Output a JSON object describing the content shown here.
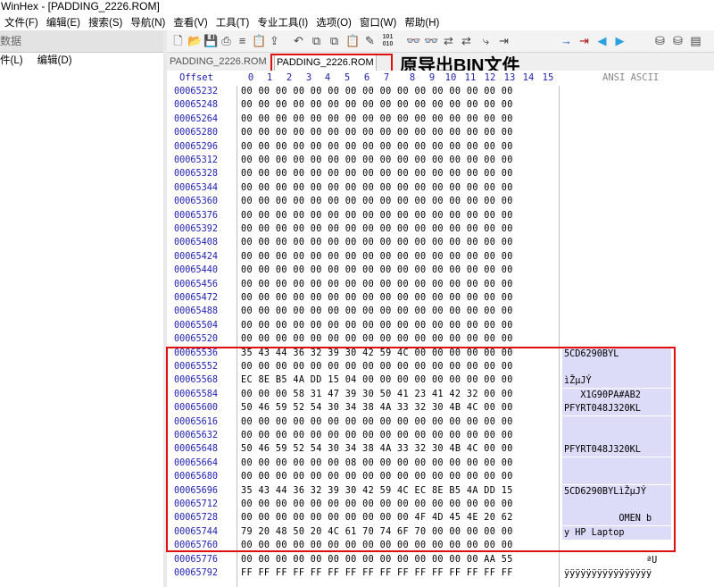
{
  "window": {
    "title": "WinHex - [PADDING_2226.ROM]"
  },
  "menu": [
    "文件(F)",
    "编辑(E)",
    "搜索(S)",
    "导航(N)",
    "查看(V)",
    "工具(T)",
    "专业工具(I)",
    "选项(O)",
    "窗口(W)",
    "帮助(H)"
  ],
  "left_pane": {
    "header": "数据",
    "menu": [
      "件(L)",
      "编辑(D)"
    ]
  },
  "toolbar_icons": [
    "new-file-icon",
    "open-folder-icon",
    "save-icon",
    "print-icon",
    "properties-icon",
    "clipboard-icon",
    "export-icon",
    "undo-icon",
    "copy-icon",
    "copy-block-icon",
    "paste-icon",
    "write-icon",
    "hex-101-icon",
    "find-text-icon",
    "find-hex-icon",
    "replace-icon",
    "replace-hex-icon",
    "goto-icon",
    "goto-offset-icon",
    "back-icon",
    "forward-icon",
    "disk-icon",
    "disk-edit-icon",
    "ram-icon"
  ],
  "tabs": [
    {
      "label": "PADDING_2226.ROM",
      "active": false
    },
    {
      "label": "PADDING_2226.ROM",
      "active": true
    }
  ],
  "annotation": {
    "text": "原导出BIN文件",
    "color": "#e01010"
  },
  "hex": {
    "offset_header": "Offset",
    "columns": [
      "0",
      "1",
      "2",
      "3",
      "4",
      "5",
      "6",
      "7",
      "8",
      "9",
      "10",
      "11",
      "12",
      "13",
      "14",
      "15"
    ],
    "ascii_header": "ANSI ASCII",
    "rows": [
      {
        "offset": "00065232",
        "bytes": "00 00 00 00 00 00 00 00 00 00 00 00 00 00 00 00",
        "ascii": "",
        "hl": false
      },
      {
        "offset": "00065248",
        "bytes": "00 00 00 00 00 00 00 00 00 00 00 00 00 00 00 00",
        "ascii": "",
        "hl": false
      },
      {
        "offset": "00065264",
        "bytes": "00 00 00 00 00 00 00 00 00 00 00 00 00 00 00 00",
        "ascii": "",
        "hl": false
      },
      {
        "offset": "00065280",
        "bytes": "00 00 00 00 00 00 00 00 00 00 00 00 00 00 00 00",
        "ascii": "",
        "hl": false
      },
      {
        "offset": "00065296",
        "bytes": "00 00 00 00 00 00 00 00 00 00 00 00 00 00 00 00",
        "ascii": "",
        "hl": false
      },
      {
        "offset": "00065312",
        "bytes": "00 00 00 00 00 00 00 00 00 00 00 00 00 00 00 00",
        "ascii": "",
        "hl": false
      },
      {
        "offset": "00065328",
        "bytes": "00 00 00 00 00 00 00 00 00 00 00 00 00 00 00 00",
        "ascii": "",
        "hl": false
      },
      {
        "offset": "00065344",
        "bytes": "00 00 00 00 00 00 00 00 00 00 00 00 00 00 00 00",
        "ascii": "",
        "hl": false
      },
      {
        "offset": "00065360",
        "bytes": "00 00 00 00 00 00 00 00 00 00 00 00 00 00 00 00",
        "ascii": "",
        "hl": false
      },
      {
        "offset": "00065376",
        "bytes": "00 00 00 00 00 00 00 00 00 00 00 00 00 00 00 00",
        "ascii": "",
        "hl": false
      },
      {
        "offset": "00065392",
        "bytes": "00 00 00 00 00 00 00 00 00 00 00 00 00 00 00 00",
        "ascii": "",
        "hl": false
      },
      {
        "offset": "00065408",
        "bytes": "00 00 00 00 00 00 00 00 00 00 00 00 00 00 00 00",
        "ascii": "",
        "hl": false
      },
      {
        "offset": "00065424",
        "bytes": "00 00 00 00 00 00 00 00 00 00 00 00 00 00 00 00",
        "ascii": "",
        "hl": false
      },
      {
        "offset": "00065440",
        "bytes": "00 00 00 00 00 00 00 00 00 00 00 00 00 00 00 00",
        "ascii": "",
        "hl": false
      },
      {
        "offset": "00065456",
        "bytes": "00 00 00 00 00 00 00 00 00 00 00 00 00 00 00 00",
        "ascii": "",
        "hl": false
      },
      {
        "offset": "00065472",
        "bytes": "00 00 00 00 00 00 00 00 00 00 00 00 00 00 00 00",
        "ascii": "",
        "hl": false
      },
      {
        "offset": "00065488",
        "bytes": "00 00 00 00 00 00 00 00 00 00 00 00 00 00 00 00",
        "ascii": "",
        "hl": false
      },
      {
        "offset": "00065504",
        "bytes": "00 00 00 00 00 00 00 00 00 00 00 00 00 00 00 00",
        "ascii": "",
        "hl": false
      },
      {
        "offset": "00065520",
        "bytes": "00 00 00 00 00 00 00 00 00 00 00 00 00 00 00 00",
        "ascii": "",
        "hl": false
      },
      {
        "offset": "00065536",
        "bytes": "35 43 44 36 32 39 30 42 59 4C 00 00 00 00 00 00",
        "ascii": "5CD6290BYL",
        "hl": true
      },
      {
        "offset": "00065552",
        "bytes": "00 00 00 00 00 00 00 00 00 00 00 00 00 00 00 00",
        "ascii": "",
        "hl": true
      },
      {
        "offset": "00065568",
        "bytes": "EC 8E B5 4A DD 15 04 00 00 00 00 00 00 00 00 00",
        "ascii": "ìŽµJÝ",
        "hl": true
      },
      {
        "offset": "00065584",
        "bytes": "00 00 00 58 31 47 39 30 50 41 23 41 42 32 00 00",
        "ascii": "   X1G90PA#AB2",
        "hl": true
      },
      {
        "offset": "00065600",
        "bytes": "50 46 59 52 54 30 34 38 4A 33 32 30 4B 4C 00 00",
        "ascii": "PFYRT048J320KL",
        "hl": true
      },
      {
        "offset": "00065616",
        "bytes": "00 00 00 00 00 00 00 00 00 00 00 00 00 00 00 00",
        "ascii": "",
        "hl": true
      },
      {
        "offset": "00065632",
        "bytes": "00 00 00 00 00 00 00 00 00 00 00 00 00 00 00 00",
        "ascii": "",
        "hl": true
      },
      {
        "offset": "00065648",
        "bytes": "50 46 59 52 54 30 34 38 4A 33 32 30 4B 4C 00 00",
        "ascii": "PFYRT048J320KL",
        "hl": true
      },
      {
        "offset": "00065664",
        "bytes": "00 00 00 00 00 00 08 00 00 00 00 00 00 00 00 00",
        "ascii": "",
        "hl": true
      },
      {
        "offset": "00065680",
        "bytes": "00 00 00 00 00 00 00 00 00 00 00 00 00 00 00 00",
        "ascii": "",
        "hl": true
      },
      {
        "offset": "00065696",
        "bytes": "35 43 44 36 32 39 30 42 59 4C EC 8E B5 4A DD 15",
        "ascii": "5CD6290BYLìŽµJÝ",
        "hl": true
      },
      {
        "offset": "00065712",
        "bytes": "00 00 00 00 00 00 00 00 00 00 00 00 00 00 00 00",
        "ascii": "",
        "hl": true
      },
      {
        "offset": "00065728",
        "bytes": "00 00 00 00 00 00 00 00 00 00 4F 4D 45 4E 20 62",
        "ascii": "          OMEN b",
        "hl": true
      },
      {
        "offset": "00065744",
        "bytes": "79 20 48 50 20 4C 61 70 74 6F 70 00 00 00 00 00",
        "ascii": "y HP Laptop",
        "hl": true
      },
      {
        "offset": "00065760",
        "bytes": "00 00 00 00 00 00 00 00 00 00 00 00 00 00 00 00",
        "ascii": "",
        "hl": false
      },
      {
        "offset": "00065776",
        "bytes": "00 00 00 00 00 00 00 00 00 00 00 00 00 00 AA 55",
        "ascii": "               ªU",
        "hl": false
      },
      {
        "offset": "00065792",
        "bytes": "FF FF FF FF FF FF FF FF FF FF FF FF FF FF FF FF",
        "ascii": "ÿÿÿÿÿÿÿÿÿÿÿÿÿÿÿÿ",
        "hl": false
      }
    ]
  }
}
